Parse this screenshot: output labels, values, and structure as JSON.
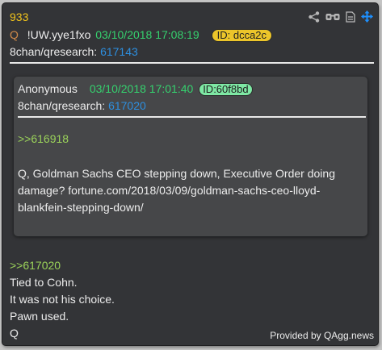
{
  "post": {
    "number": "933",
    "q_label": "Q",
    "tripcode": "!UW.yye1fxo",
    "date": "03/10/2018 17:08:19",
    "id": "ID: dcca2c",
    "board": "8chan/qresearch:",
    "post_ref": "617143"
  },
  "quoted": {
    "author": "Anonymous",
    "date": "03/10/2018 17:01:40",
    "id": "ID:60f8bd",
    "board": "8chan/qresearch:",
    "post_ref": "617020",
    "reply_ref": ">>616918",
    "body": "Q, Goldman Sachs CEO stepping down, Executive Order doing damage? fortune.com/2018/03/09/goldman-sachs-ceo-lloyd-blankfein-stepping-down/"
  },
  "message": {
    "reply_ref": ">>617020",
    "lines": [
      "Tied to Cohn.",
      "It was not his choice.",
      "Pawn used.",
      "Q"
    ]
  },
  "credit": "Provided by QAgg.news",
  "toolbar": {
    "icons": [
      "share-icon",
      "glasses-icon",
      "document-icon",
      "move-icon"
    ],
    "accent": "#1e90ff"
  },
  "colors": {
    "card_bg": "#333437",
    "inner_bg": "#464749",
    "number": "#f3c51b",
    "date": "#35d16e",
    "link": "#2d8fe0",
    "reply": "#9bd35a",
    "id_badge": "#ecc52a",
    "id_badge_quoted": "#7ee8a4"
  }
}
